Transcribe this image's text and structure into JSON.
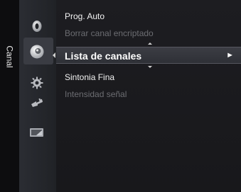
{
  "sidebar": {
    "tab_label": "Canal",
    "icons": [
      "picture-icon",
      "channel-icon",
      "setup-icon",
      "input-icon",
      "application-icon"
    ],
    "selected_index": 1
  },
  "menu": {
    "items": [
      {
        "label": "Prog. Auto",
        "state": "normal"
      },
      {
        "label": "Borrar canal encriptado",
        "state": "disabled"
      },
      {
        "label": "Lista de canales",
        "state": "selected"
      },
      {
        "label": "Sintonia Fina",
        "state": "normal"
      },
      {
        "label": "Intensidad señal",
        "state": "disabled"
      }
    ],
    "submenu_arrow": "►"
  },
  "colors": {
    "background": "#1b1b1f",
    "text": "#f2f2f2",
    "disabled_text": "#6c6d72",
    "highlight": "#3a3c43"
  }
}
